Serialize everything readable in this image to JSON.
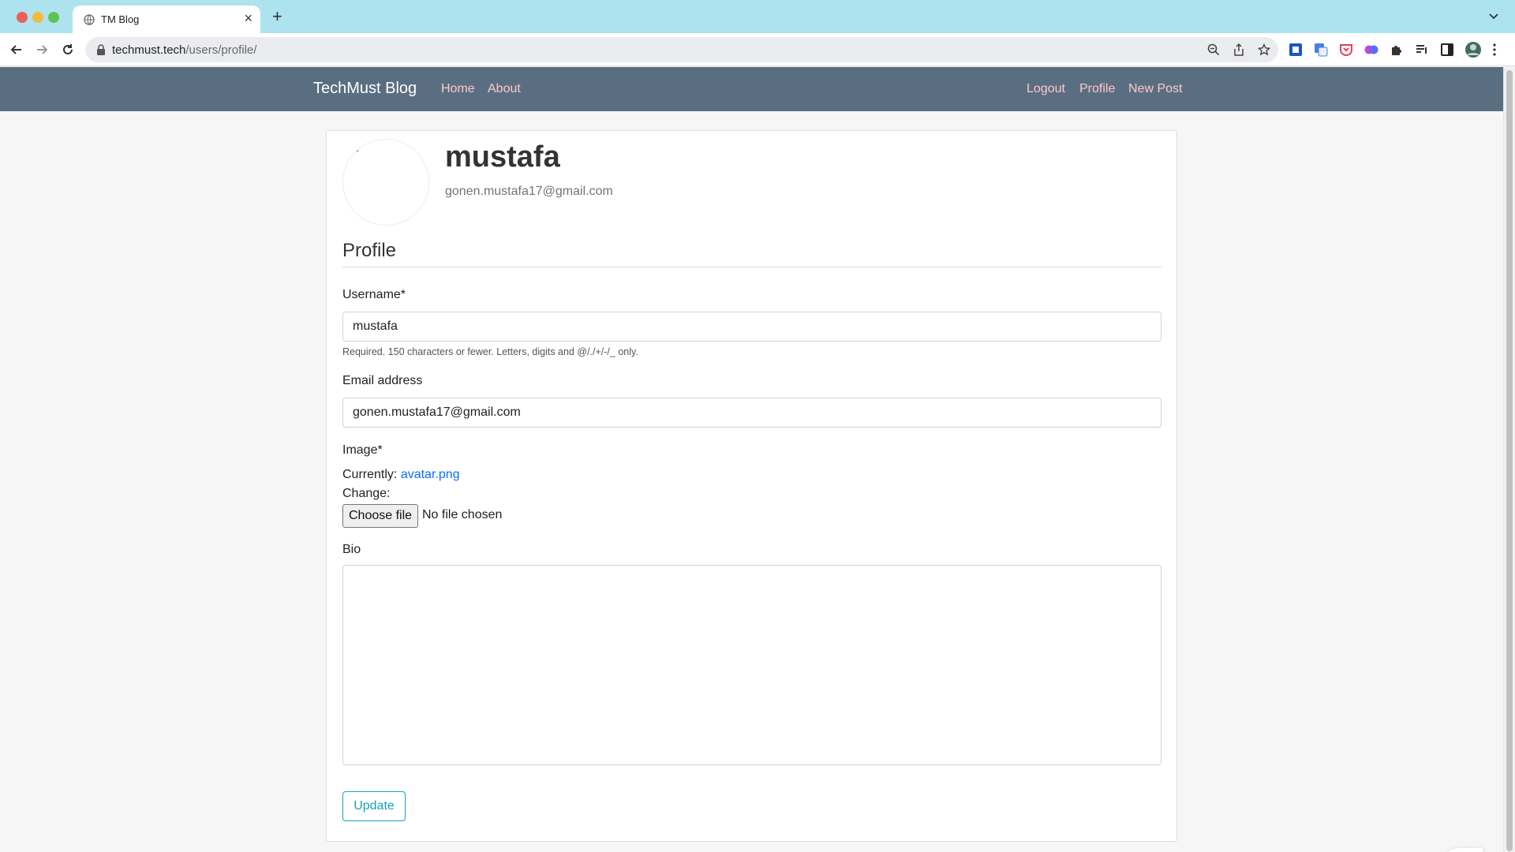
{
  "browser": {
    "tab_title": "TM Blog",
    "url_host": "techmust.tech",
    "url_path": "/users/profile/"
  },
  "navbar": {
    "brand": "TechMust Blog",
    "left_links": [
      "Home",
      "About"
    ],
    "right_links": [
      "Logout",
      "Profile",
      "New Post"
    ]
  },
  "profile": {
    "username": "mustafa",
    "email": "gonen.mustafa17@gmail.com"
  },
  "form": {
    "legend": "Profile",
    "username_label": "Username*",
    "username_value": "mustafa",
    "username_help": "Required. 150 characters or fewer. Letters, digits and @/./+/-/_ only.",
    "email_label": "Email address",
    "email_value": "gonen.mustafa17@gmail.com",
    "image_label": "Image*",
    "currently_label": "Currently:",
    "current_file": "avatar.png",
    "change_label": "Change:",
    "file_button": "Choose file",
    "file_status": "No file chosen",
    "bio_label": "Bio",
    "bio_value": "",
    "submit_label": "Update"
  },
  "colors": {
    "navbar_bg": "#5a6e82",
    "nav_link": "#ffc9c9",
    "link": "#0d6efd",
    "button_outline": "#17a2b8",
    "tabbar_bg": "#ade3ef"
  }
}
